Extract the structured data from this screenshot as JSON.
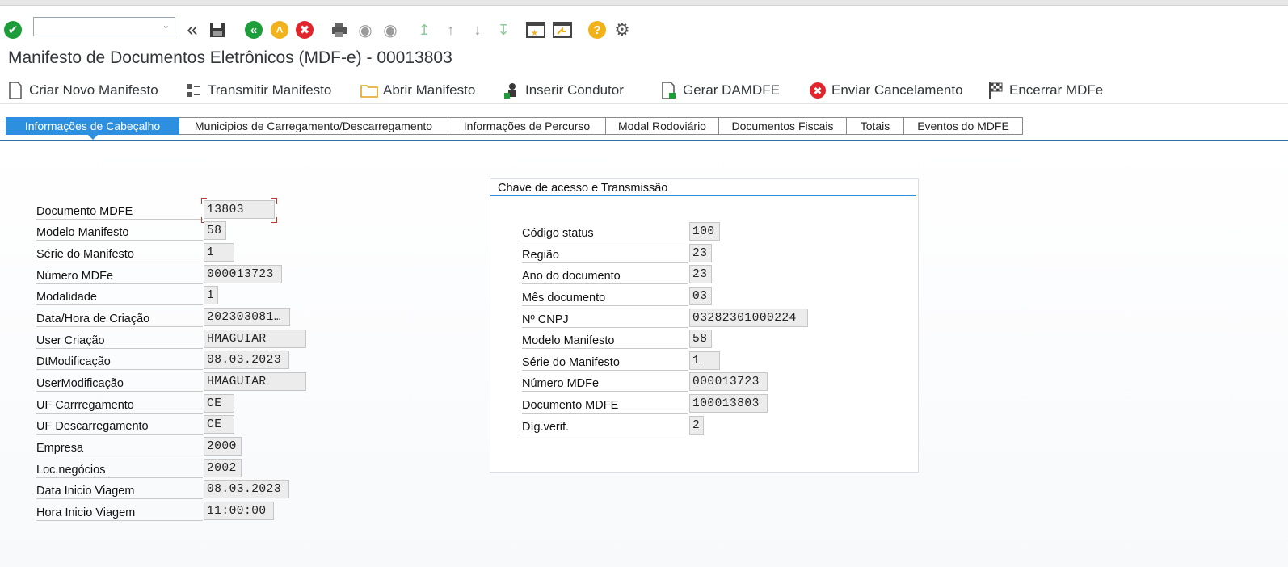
{
  "toolbar": {
    "command_value": "",
    "icons": [
      "enter-icon",
      "back-double-icon",
      "save-icon",
      "back-icon",
      "exit-icon",
      "cancel-icon",
      "print-icon",
      "find-icon",
      "find-next-icon",
      "first-page-icon",
      "prev-page-icon",
      "next-page-icon",
      "last-page-icon",
      "new-session-icon",
      "shortcut-icon",
      "help-icon",
      "settings-icon"
    ]
  },
  "title": "Manifesto de Documentos Eletrônicos (MDF-e) - 00013803",
  "actions": [
    {
      "label": "Criar Novo Manifesto",
      "icon": "document-icon"
    },
    {
      "label": "Transmitir Manifesto",
      "icon": "transmit-icon"
    },
    {
      "label": "Abrir Manifesto",
      "icon": "folder-icon"
    },
    {
      "label": "Inserir Condutor",
      "icon": "driver-icon"
    },
    {
      "label": "Gerar DAMDFE",
      "icon": "generate-document-icon"
    },
    {
      "label": "Enviar Cancelamento",
      "icon": "cancel-icon"
    },
    {
      "label": "Encerrar MDFe",
      "icon": "finish-flag-icon"
    }
  ],
  "tabs": [
    "Informações de Cabeçalho",
    "Municipios de Carregamento/Descarregamento",
    "Informações de Percurso",
    "Modal Rodoviário",
    "Documentos Fiscais",
    "Totais",
    "Eventos do MDFE"
  ],
  "header_fields": [
    {
      "label": "Documento MDFE",
      "value": "13803"
    },
    {
      "label": "Modelo Manifesto",
      "value": "58"
    },
    {
      "label": "Série do Manifesto",
      "value": "1"
    },
    {
      "label": "Número MDFe",
      "value": "000013723"
    },
    {
      "label": "Modalidade",
      "value": "1"
    },
    {
      "label": "Data/Hora de Criação",
      "value": "202303081…"
    },
    {
      "label": "User Criação",
      "value": "HMAGUIAR"
    },
    {
      "label": "DtModificação",
      "value": "08.03.2023"
    },
    {
      "label": "UserModificação",
      "value": "HMAGUIAR"
    },
    {
      "label": "UF Carrregamento",
      "value": "CE"
    },
    {
      "label": "UF Descarregamento",
      "value": "CE"
    },
    {
      "label": "Empresa",
      "value": "2000"
    },
    {
      "label": "Loc.negócios",
      "value": "2002"
    },
    {
      "label": "Data Inicio Viagem",
      "value": "08.03.2023"
    },
    {
      "label": "Hora Inicio Viagem",
      "value": "11:00:00"
    }
  ],
  "access_group": {
    "title": "Chave de acesso e Transmissão",
    "fields": [
      {
        "label": "Código status",
        "value": "100"
      },
      {
        "label": "Região",
        "value": "23"
      },
      {
        "label": "Ano do documento",
        "value": "23"
      },
      {
        "label": "Mês documento",
        "value": "03"
      },
      {
        "label": "Nº CNPJ",
        "value": "03282301000224"
      },
      {
        "label": "Modelo Manifesto",
        "value": "58"
      },
      {
        "label": "Série do Manifesto",
        "value": "1"
      },
      {
        "label": "Número MDFe",
        "value": "000013723"
      },
      {
        "label": "Documento MDFE",
        "value": "100013803"
      },
      {
        "label": "Díg.verif.",
        "value": "2"
      }
    ]
  },
  "colors": {
    "accent": "#2d8fe0",
    "ok": "#1e9e3a",
    "cancel": "#e0262c",
    "warn": "#f2b21b"
  }
}
